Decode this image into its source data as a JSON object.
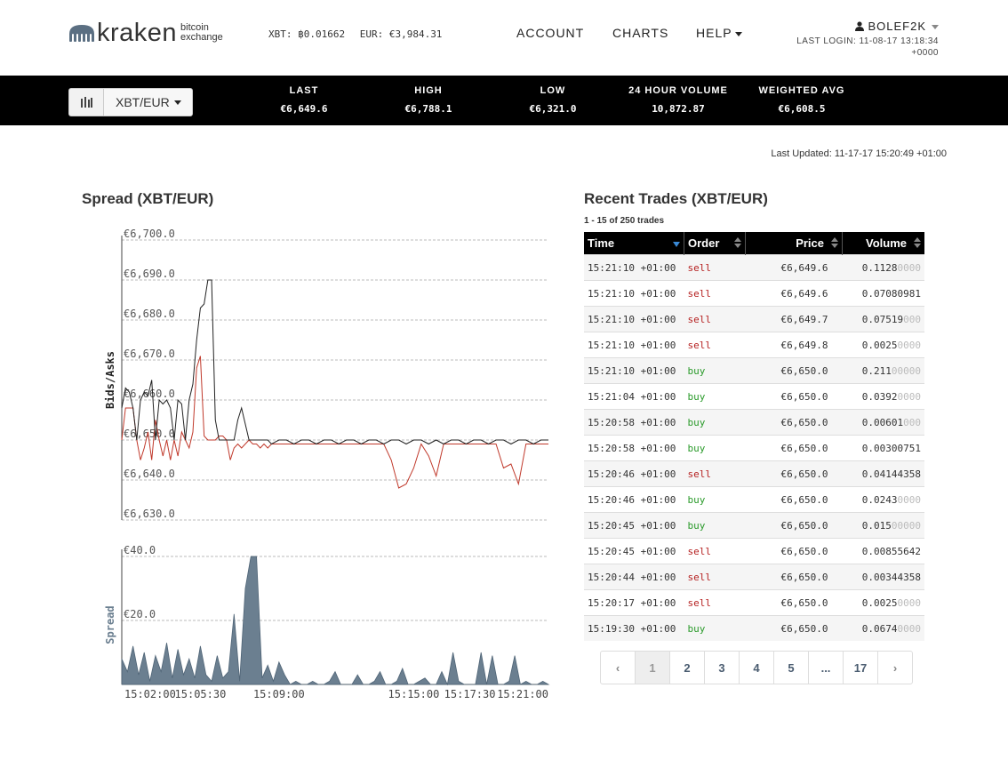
{
  "header": {
    "logo_word": "kraken",
    "logo_sub_line1": "bitcoin",
    "logo_sub_line2": "exchange",
    "balances": [
      "XBT: ฿0.01662",
      "EUR: €3,984.31"
    ],
    "nav": [
      "ACCOUNT",
      "CHARTS",
      "HELP"
    ],
    "username": "BOLEF2K",
    "last_login": "LAST LOGIN: 11-08-17 13:18:34",
    "last_login_tz": "+0000"
  },
  "ticker": {
    "pair": "XBT/EUR",
    "stats": [
      {
        "label": "LAST",
        "value": "€6,649.6"
      },
      {
        "label": "HIGH",
        "value": "€6,788.1"
      },
      {
        "label": "LOW",
        "value": "€6,321.0"
      },
      {
        "label": "24 HOUR VOLUME",
        "value": "10,872.87"
      },
      {
        "label": "WEIGHTED AVG",
        "value": "€6,608.5"
      }
    ]
  },
  "last_updated": "Last Updated: 11-17-17 15:20:49 +01:00",
  "spread_title": "Spread (XBT/EUR)",
  "chart_data": [
    {
      "type": "line",
      "ylabel": "Bids/Asks",
      "yticks": [
        "€6,700.0",
        "€6,690.0",
        "€6,680.0",
        "€6,670.0",
        "€6,660.0",
        "€6,650.0",
        "€6,640.0",
        "€6,630.0"
      ],
      "ylim": [
        6630,
        6700
      ],
      "xlim": [
        0,
        1140
      ],
      "x_unit": "seconds after 15:02:00",
      "grid": true,
      "colors": {
        "asks": "#222222",
        "bids": "#c0392b"
      },
      "series": [
        {
          "name": "",
          "x": [
            0,
            10,
            20,
            30,
            40,
            50,
            60,
            70,
            80,
            90,
            100,
            110,
            120,
            130,
            140,
            150,
            160,
            170,
            180,
            190,
            200,
            210,
            220,
            230,
            240,
            250,
            260,
            270,
            280,
            290,
            300,
            310,
            320,
            330,
            340,
            350,
            360,
            370,
            380,
            390,
            400,
            420,
            440,
            460,
            480,
            500,
            520,
            540,
            560,
            580,
            600,
            620,
            640,
            660,
            680,
            700,
            720,
            740,
            760,
            780,
            800,
            820,
            840,
            860,
            880,
            900,
            920,
            940,
            960,
            980,
            1000,
            1020,
            1040,
            1060,
            1080,
            1100,
            1120,
            1140
          ],
          "values": [
            6658,
            6663,
            6662,
            6658,
            6650,
            6660,
            6662,
            6661,
            6665,
            6650,
            6660,
            6659,
            6660,
            6658,
            6650,
            6660,
            6659,
            6650,
            6660,
            6664,
            6675,
            6683,
            6684,
            6690,
            6690,
            6655,
            6650,
            6650,
            6650,
            6650,
            6650,
            6655,
            6658,
            6654,
            6650,
            6650,
            6650,
            6650,
            6650,
            6650,
            6649,
            6650,
            6650,
            6649,
            6650,
            6650,
            6649,
            6650,
            6650,
            6649,
            6650,
            6650,
            6649,
            6650,
            6650,
            6649,
            6650,
            6650,
            6649,
            6650,
            6650,
            6649,
            6650,
            6649,
            6650,
            6650,
            6649,
            6650,
            6650,
            6649,
            6650,
            6650,
            6649,
            6650,
            6650,
            6649,
            6650,
            6650
          ]
        },
        {
          "name": "",
          "x": [
            0,
            10,
            20,
            30,
            40,
            50,
            60,
            70,
            80,
            90,
            100,
            110,
            120,
            130,
            140,
            150,
            160,
            170,
            180,
            190,
            200,
            210,
            220,
            230,
            240,
            250,
            260,
            270,
            280,
            290,
            300,
            310,
            320,
            330,
            340,
            350,
            360,
            370,
            380,
            390,
            400,
            420,
            440,
            460,
            480,
            500,
            520,
            540,
            560,
            580,
            600,
            620,
            640,
            660,
            680,
            700,
            720,
            740,
            760,
            780,
            800,
            820,
            840,
            860,
            880,
            900,
            920,
            940,
            960,
            980,
            1000,
            1020,
            1040,
            1060,
            1080,
            1100,
            1120,
            1140
          ],
          "values": [
            6650,
            6658,
            6658,
            6658,
            6650,
            6645,
            6648,
            6652,
            6645,
            6655,
            6650,
            6646,
            6650,
            6645,
            6650,
            6646,
            6652,
            6650,
            6648,
            6652,
            6668,
            6671,
            6651,
            6650,
            6650,
            6650,
            6651,
            6651,
            6650,
            6645,
            6648,
            6649,
            6648,
            6649,
            6650,
            6649,
            6649,
            6648,
            6649,
            6648,
            6649,
            6649,
            6649,
            6649,
            6649,
            6649,
            6649,
            6649,
            6649,
            6649,
            6649,
            6649,
            6649,
            6649,
            6649,
            6649,
            6645,
            6638,
            6639,
            6643,
            6649,
            6646,
            6641,
            6649,
            6649,
            6649,
            6649,
            6649,
            6649,
            6649,
            6649,
            6643,
            6644,
            6639,
            6649,
            6649,
            6649,
            6649
          ]
        }
      ]
    },
    {
      "type": "area",
      "ylabel": "Spread",
      "yticks": [
        "€40.0",
        "€20.0",
        "€0.0"
      ],
      "ylim": [
        0,
        40
      ],
      "xlim": [
        0,
        1140
      ],
      "x_unit": "seconds after 15:02:00",
      "grid": true,
      "color": "#6b7f90",
      "xticks": [
        "15:02:00",
        "15:05:30",
        "15:09:00",
        "15:15:00",
        "15:17:30",
        "15:21:00"
      ],
      "xtick_positions": [
        0,
        210,
        420,
        780,
        930,
        1140
      ],
      "series": [
        {
          "name": "",
          "x": [
            0,
            15,
            30,
            45,
            60,
            75,
            90,
            105,
            120,
            135,
            150,
            165,
            180,
            195,
            210,
            225,
            240,
            255,
            270,
            285,
            300,
            315,
            330,
            345,
            360,
            375,
            390,
            405,
            420,
            435,
            450,
            465,
            480,
            495,
            510,
            525,
            540,
            555,
            570,
            585,
            600,
            615,
            630,
            645,
            660,
            675,
            690,
            705,
            720,
            735,
            750,
            765,
            780,
            795,
            810,
            825,
            840,
            855,
            870,
            885,
            900,
            915,
            930,
            945,
            960,
            975,
            990,
            1005,
            1020,
            1035,
            1050,
            1065,
            1080,
            1095,
            1110,
            1125,
            1140
          ],
          "values": [
            8,
            4,
            12,
            3,
            10,
            1,
            9,
            4,
            13,
            2,
            11,
            3,
            8,
            2,
            12,
            3,
            1,
            9,
            2,
            4,
            22,
            1,
            30,
            40,
            40,
            2,
            6,
            1,
            7,
            3,
            0,
            1,
            0,
            0,
            1,
            0,
            0,
            1,
            4,
            0,
            0,
            0,
            3,
            0,
            0,
            1,
            4,
            0,
            0,
            1,
            5,
            0,
            0,
            1,
            2,
            0,
            0,
            4,
            0,
            10,
            1,
            0,
            0,
            0,
            10,
            0,
            9,
            0,
            0,
            1,
            9,
            0,
            1,
            0,
            0,
            1,
            0
          ]
        }
      ]
    }
  ],
  "trades_title": "Recent Trades (XBT/EUR)",
  "trades_info": "1 - 15 of 250 trades",
  "trades_columns": [
    "Time",
    "Order",
    "Price",
    "Volume"
  ],
  "trades": [
    {
      "time": "15:21:10 +01:00",
      "order": "sell",
      "price": "€6,649.6",
      "vol": "0.1128",
      "pad": "0000"
    },
    {
      "time": "15:21:10 +01:00",
      "order": "sell",
      "price": "€6,649.6",
      "vol": "0.07080981",
      "pad": ""
    },
    {
      "time": "15:21:10 +01:00",
      "order": "sell",
      "price": "€6,649.7",
      "vol": "0.07519",
      "pad": "000"
    },
    {
      "time": "15:21:10 +01:00",
      "order": "sell",
      "price": "€6,649.8",
      "vol": "0.0025",
      "pad": "0000"
    },
    {
      "time": "15:21:10 +01:00",
      "order": "buy",
      "price": "€6,650.0",
      "vol": "0.211",
      "pad": "00000"
    },
    {
      "time": "15:21:04 +01:00",
      "order": "buy",
      "price": "€6,650.0",
      "vol": "0.0392",
      "pad": "0000"
    },
    {
      "time": "15:20:58 +01:00",
      "order": "buy",
      "price": "€6,650.0",
      "vol": "0.00601",
      "pad": "000"
    },
    {
      "time": "15:20:58 +01:00",
      "order": "buy",
      "price": "€6,650.0",
      "vol": "0.00300751",
      "pad": ""
    },
    {
      "time": "15:20:46 +01:00",
      "order": "sell",
      "price": "€6,650.0",
      "vol": "0.04144358",
      "pad": ""
    },
    {
      "time": "15:20:46 +01:00",
      "order": "buy",
      "price": "€6,650.0",
      "vol": "0.0243",
      "pad": "0000"
    },
    {
      "time": "15:20:45 +01:00",
      "order": "buy",
      "price": "€6,650.0",
      "vol": "0.015",
      "pad": "00000"
    },
    {
      "time": "15:20:45 +01:00",
      "order": "sell",
      "price": "€6,650.0",
      "vol": "0.00855642",
      "pad": ""
    },
    {
      "time": "15:20:44 +01:00",
      "order": "sell",
      "price": "€6,650.0",
      "vol": "0.00344358",
      "pad": ""
    },
    {
      "time": "15:20:17 +01:00",
      "order": "sell",
      "price": "€6,650.0",
      "vol": "0.0025",
      "pad": "0000"
    },
    {
      "time": "15:19:30 +01:00",
      "order": "buy",
      "price": "€6,650.0",
      "vol": "0.0674",
      "pad": "0000"
    }
  ],
  "pagination": [
    "‹",
    "1",
    "2",
    "3",
    "4",
    "5",
    "...",
    "17",
    "›"
  ],
  "pagination_active": "1"
}
